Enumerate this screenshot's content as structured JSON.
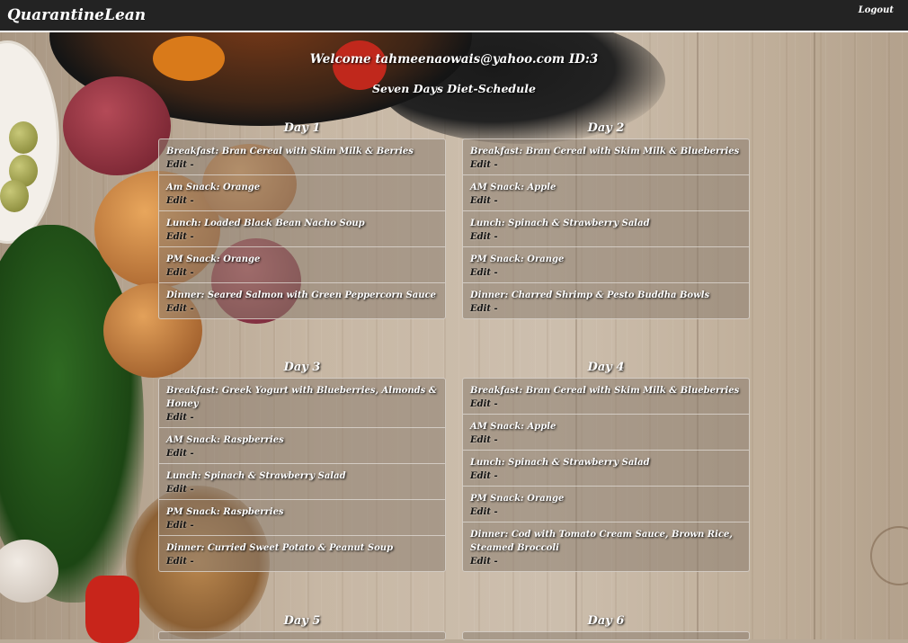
{
  "app": {
    "title": "QuarantineLean",
    "logout_label": "Logout"
  },
  "welcome": "Welcome tahmeenaowais@yahoo.com ID:3",
  "subtitle": "Seven Days Diet-Schedule",
  "edit_label": "Edit",
  "edit_separator": "-",
  "days": [
    {
      "title": "Day 1",
      "meals": [
        "Breakfast: Bran Cereal with Skim Milk & Berries",
        "Am Snack: Orange",
        "Lunch: Loaded Black Bean Nacho Soup",
        "PM Snack: Orange",
        "Dinner: Seared Salmon with Green Peppercorn Sauce"
      ]
    },
    {
      "title": "Day 2",
      "meals": [
        "Breakfast: Bran Cereal with Skim Milk & Blueberries",
        "AM Snack: Apple",
        "Lunch: Spinach & Strawberry Salad",
        "PM Snack: Orange",
        "Dinner: Charred Shrimp & Pesto Buddha Bowls"
      ]
    },
    {
      "title": "Day 3",
      "meals": [
        "Breakfast: Greek Yogurt with Blueberries, Almonds & Honey",
        "AM Snack: Raspberries",
        "Lunch: Spinach & Strawberry Salad",
        "PM Snack: Raspberries",
        "Dinner: Curried Sweet Potato & Peanut Soup"
      ]
    },
    {
      "title": "Day 4",
      "meals": [
        "Breakfast: Bran Cereal with Skim Milk & Blueberries",
        "AM Snack: Apple",
        "Lunch: Spinach & Strawberry Salad",
        "PM Snack: Orange",
        "Dinner: Cod with Tomato Cream Sauce, Brown Rice, Steamed Broccoli"
      ]
    },
    {
      "title": "Day 5",
      "meals": []
    },
    {
      "title": "Day 6",
      "meals": []
    }
  ]
}
